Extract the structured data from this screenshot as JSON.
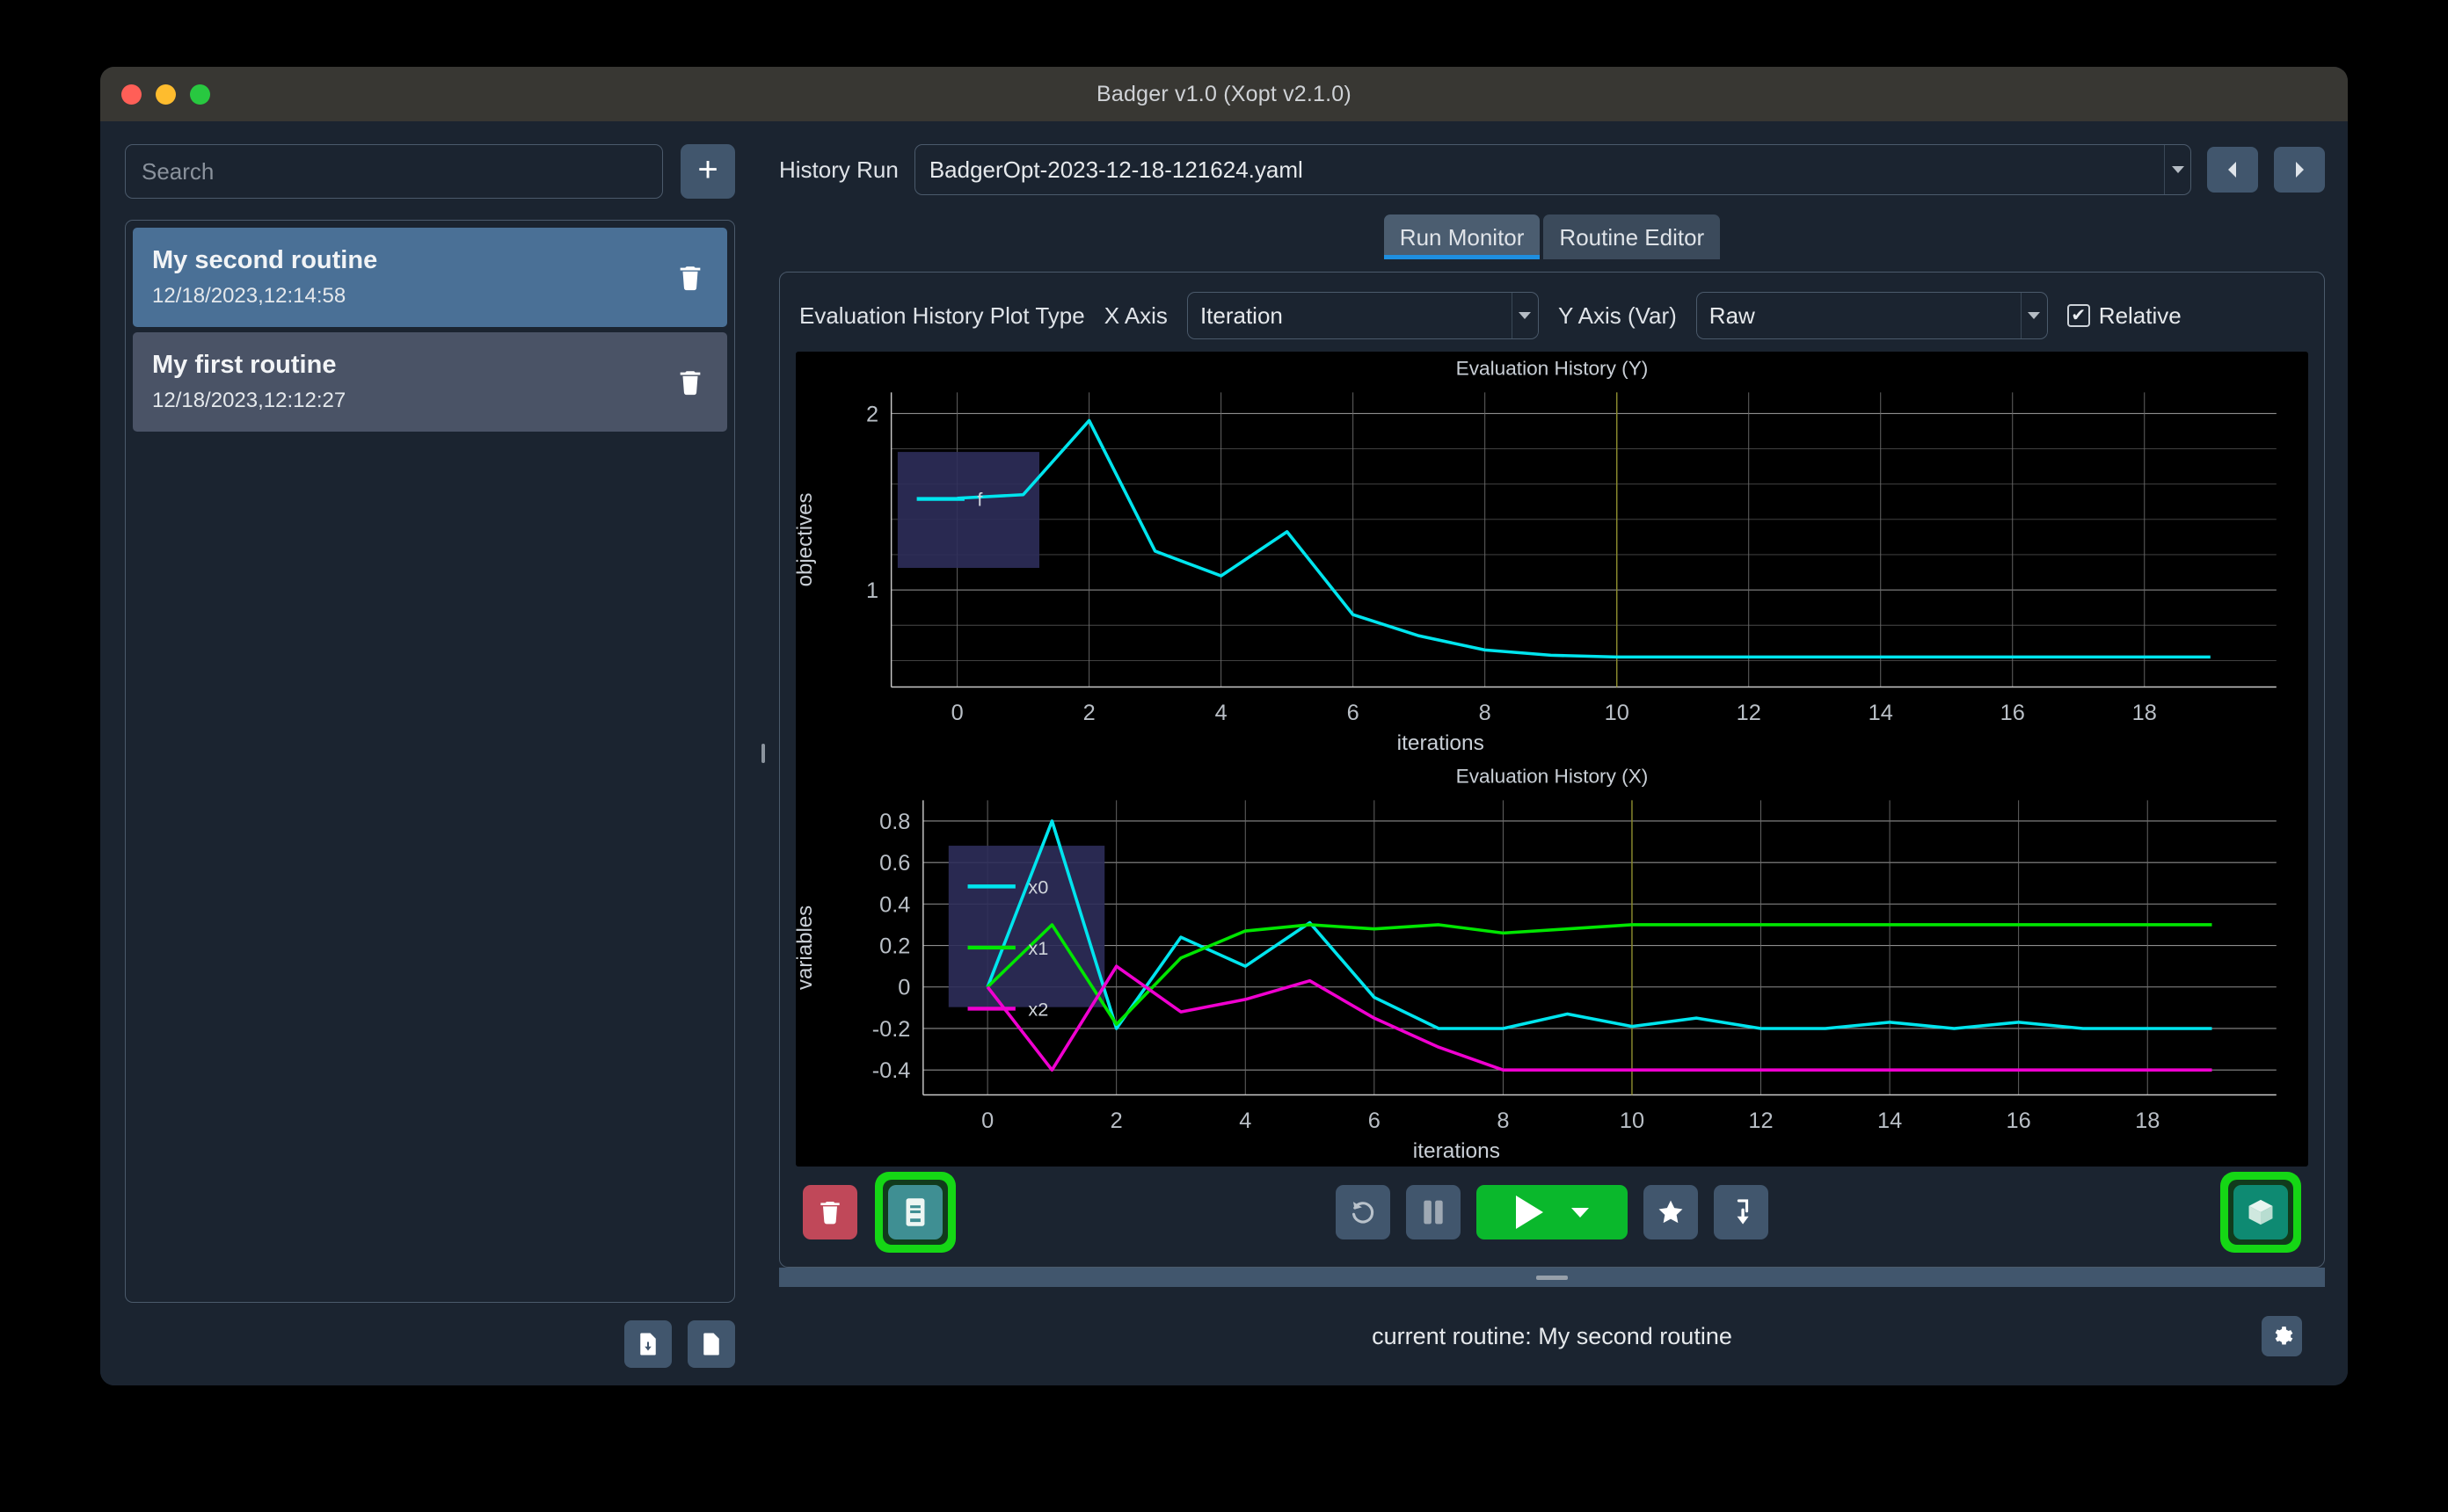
{
  "window": {
    "title": "Badger v1.0 (Xopt v2.1.0)",
    "traffic_lights": [
      "close",
      "minimize",
      "maximize"
    ]
  },
  "sidebar": {
    "search": {
      "placeholder": "Search",
      "value": ""
    },
    "add_button_label": "+",
    "routines": [
      {
        "name": "My second routine",
        "timestamp": "12/18/2023,12:14:58",
        "selected": true
      },
      {
        "name": "My first routine",
        "timestamp": "12/18/2023,12:12:27",
        "selected": false
      }
    ],
    "footer_buttons": [
      {
        "name": "import-routine",
        "icon": "file-download-icon"
      },
      {
        "name": "export-routine",
        "icon": "file-upload-icon"
      }
    ]
  },
  "history": {
    "label": "History Run",
    "value": "BadgerOpt-2023-12-18-121624.yaml",
    "prev_label": "◀",
    "next_label": "▶"
  },
  "tabs": [
    {
      "label": "Run Monitor",
      "active": true
    },
    {
      "label": "Routine Editor",
      "active": false
    }
  ],
  "controls": {
    "plot_type_label": "Evaluation History Plot Type",
    "x_axis_label": "X Axis",
    "x_axis_value": "Iteration",
    "y_axis_label": "Y Axis (Var)",
    "y_axis_value": "Raw",
    "relative_label": "Relative",
    "relative_checked": true,
    "check_glyph": "✔"
  },
  "toolbar": {
    "left": [
      {
        "name": "delete-run-button",
        "icon": "trash-icon",
        "style": "danger",
        "highlighted": false
      },
      {
        "name": "logbook-button",
        "icon": "logbook-icon",
        "style": "teal",
        "highlighted": true
      }
    ],
    "center": [
      {
        "name": "reset-button",
        "icon": "reset-icon"
      },
      {
        "name": "pause-button",
        "icon": "pause-icon"
      },
      {
        "name": "run-button",
        "icon": "play-icon"
      },
      {
        "name": "favorite-button",
        "icon": "star-icon"
      },
      {
        "name": "jump-to-optimal-button",
        "icon": "arrow-down-to-bracket-icon"
      }
    ],
    "right": [
      {
        "name": "extensions-button",
        "icon": "cube-icon",
        "style": "teal-dark",
        "highlighted": true
      }
    ]
  },
  "statusbar": {
    "text": "current routine: My second routine",
    "settings_icon": "gear-icon"
  },
  "colors": {
    "accent_blue": "#1e8fe0",
    "selected_routine": "#4a7096",
    "run_green": "#0ab82c",
    "highlight_green": "#15d715",
    "danger_red": "#c04859",
    "series_cyan": "#00e5ee",
    "series_green": "#00e600",
    "series_magenta": "#f000d0",
    "panel_bg": "#1b2430",
    "border": "#4b5a6b"
  },
  "chart_data": [
    {
      "type": "line",
      "name": "evaluation-history-y",
      "title": "Evaluation History (Y)",
      "xlabel": "iterations",
      "ylabel": "objectives",
      "xlim": [
        -1,
        20
      ],
      "ylim": [
        0.45,
        2.12
      ],
      "xticks": [
        0,
        2,
        4,
        6,
        8,
        10,
        12,
        14,
        16,
        18
      ],
      "yticks": [
        1,
        2
      ],
      "minor_ytick_step": 0.2,
      "grid": true,
      "legend": {
        "position": "top-left",
        "entries": [
          "f"
        ]
      },
      "marker_line_x": 10,
      "x": [
        0,
        1,
        2,
        3,
        4,
        5,
        6,
        7,
        8,
        9,
        10,
        11,
        12,
        13,
        14,
        15,
        16,
        17,
        18,
        19
      ],
      "series": [
        {
          "name": "f",
          "color": "#00e5ee",
          "values": [
            1.52,
            1.54,
            1.96,
            1.22,
            1.08,
            1.33,
            0.86,
            0.74,
            0.66,
            0.63,
            0.62,
            0.62,
            0.62,
            0.62,
            0.62,
            0.62,
            0.62,
            0.62,
            0.62,
            0.62
          ]
        }
      ]
    },
    {
      "type": "line",
      "name": "evaluation-history-x",
      "title": "Evaluation History (X)",
      "xlabel": "iterations",
      "ylabel": "variables",
      "xlim": [
        -1,
        20
      ],
      "ylim": [
        -0.52,
        0.9
      ],
      "xticks": [
        0,
        2,
        4,
        6,
        8,
        10,
        12,
        14,
        16,
        18
      ],
      "yticks": [
        -0.4,
        -0.2,
        0,
        0.2,
        0.4,
        0.6,
        0.8
      ],
      "grid": true,
      "legend": {
        "position": "top-left",
        "entries": [
          "x0",
          "x1",
          "x2"
        ]
      },
      "marker_line_x": 10,
      "x": [
        0,
        1,
        2,
        3,
        4,
        5,
        6,
        7,
        8,
        9,
        10,
        11,
        12,
        13,
        14,
        15,
        16,
        17,
        18,
        19
      ],
      "series": [
        {
          "name": "x0",
          "color": "#00e5ee",
          "values": [
            0.0,
            0.8,
            -0.2,
            0.24,
            0.1,
            0.31,
            -0.05,
            -0.2,
            -0.2,
            -0.13,
            -0.19,
            -0.15,
            -0.2,
            -0.2,
            -0.17,
            -0.2,
            -0.17,
            -0.2,
            -0.2,
            -0.2
          ]
        },
        {
          "name": "x1",
          "color": "#00e600",
          "values": [
            0.0,
            0.3,
            -0.18,
            0.14,
            0.27,
            0.3,
            0.28,
            0.3,
            0.26,
            0.28,
            0.3,
            0.3,
            0.3,
            0.3,
            0.3,
            0.3,
            0.3,
            0.3,
            0.3,
            0.3
          ]
        },
        {
          "name": "x2",
          "color": "#f000d0",
          "values": [
            0.0,
            -0.4,
            0.1,
            -0.12,
            -0.06,
            0.03,
            -0.15,
            -0.29,
            -0.4,
            -0.4,
            -0.4,
            -0.4,
            -0.4,
            -0.4,
            -0.4,
            -0.4,
            -0.4,
            -0.4,
            -0.4,
            -0.4
          ]
        }
      ]
    }
  ]
}
